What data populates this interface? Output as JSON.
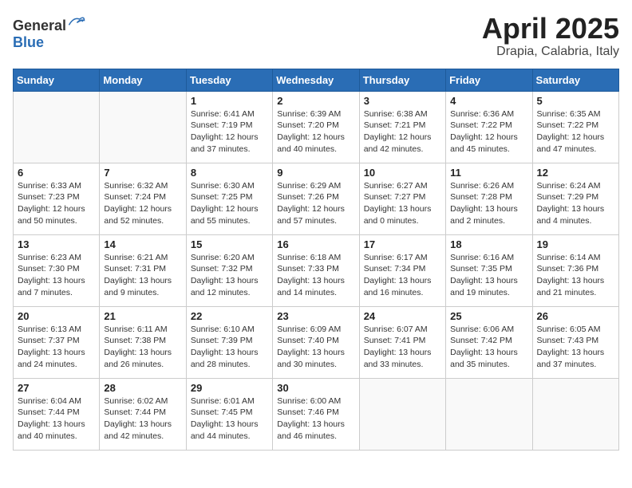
{
  "header": {
    "logo_general": "General",
    "logo_blue": "Blue",
    "month_year": "April 2025",
    "location": "Drapia, Calabria, Italy"
  },
  "weekdays": [
    "Sunday",
    "Monday",
    "Tuesday",
    "Wednesday",
    "Thursday",
    "Friday",
    "Saturday"
  ],
  "weeks": [
    [
      {
        "day": "",
        "info": ""
      },
      {
        "day": "",
        "info": ""
      },
      {
        "day": "1",
        "info": "Sunrise: 6:41 AM\nSunset: 7:19 PM\nDaylight: 12 hours\nand 37 minutes."
      },
      {
        "day": "2",
        "info": "Sunrise: 6:39 AM\nSunset: 7:20 PM\nDaylight: 12 hours\nand 40 minutes."
      },
      {
        "day": "3",
        "info": "Sunrise: 6:38 AM\nSunset: 7:21 PM\nDaylight: 12 hours\nand 42 minutes."
      },
      {
        "day": "4",
        "info": "Sunrise: 6:36 AM\nSunset: 7:22 PM\nDaylight: 12 hours\nand 45 minutes."
      },
      {
        "day": "5",
        "info": "Sunrise: 6:35 AM\nSunset: 7:22 PM\nDaylight: 12 hours\nand 47 minutes."
      }
    ],
    [
      {
        "day": "6",
        "info": "Sunrise: 6:33 AM\nSunset: 7:23 PM\nDaylight: 12 hours\nand 50 minutes."
      },
      {
        "day": "7",
        "info": "Sunrise: 6:32 AM\nSunset: 7:24 PM\nDaylight: 12 hours\nand 52 minutes."
      },
      {
        "day": "8",
        "info": "Sunrise: 6:30 AM\nSunset: 7:25 PM\nDaylight: 12 hours\nand 55 minutes."
      },
      {
        "day": "9",
        "info": "Sunrise: 6:29 AM\nSunset: 7:26 PM\nDaylight: 12 hours\nand 57 minutes."
      },
      {
        "day": "10",
        "info": "Sunrise: 6:27 AM\nSunset: 7:27 PM\nDaylight: 13 hours\nand 0 minutes."
      },
      {
        "day": "11",
        "info": "Sunrise: 6:26 AM\nSunset: 7:28 PM\nDaylight: 13 hours\nand 2 minutes."
      },
      {
        "day": "12",
        "info": "Sunrise: 6:24 AM\nSunset: 7:29 PM\nDaylight: 13 hours\nand 4 minutes."
      }
    ],
    [
      {
        "day": "13",
        "info": "Sunrise: 6:23 AM\nSunset: 7:30 PM\nDaylight: 13 hours\nand 7 minutes."
      },
      {
        "day": "14",
        "info": "Sunrise: 6:21 AM\nSunset: 7:31 PM\nDaylight: 13 hours\nand 9 minutes."
      },
      {
        "day": "15",
        "info": "Sunrise: 6:20 AM\nSunset: 7:32 PM\nDaylight: 13 hours\nand 12 minutes."
      },
      {
        "day": "16",
        "info": "Sunrise: 6:18 AM\nSunset: 7:33 PM\nDaylight: 13 hours\nand 14 minutes."
      },
      {
        "day": "17",
        "info": "Sunrise: 6:17 AM\nSunset: 7:34 PM\nDaylight: 13 hours\nand 16 minutes."
      },
      {
        "day": "18",
        "info": "Sunrise: 6:16 AM\nSunset: 7:35 PM\nDaylight: 13 hours\nand 19 minutes."
      },
      {
        "day": "19",
        "info": "Sunrise: 6:14 AM\nSunset: 7:36 PM\nDaylight: 13 hours\nand 21 minutes."
      }
    ],
    [
      {
        "day": "20",
        "info": "Sunrise: 6:13 AM\nSunset: 7:37 PM\nDaylight: 13 hours\nand 24 minutes."
      },
      {
        "day": "21",
        "info": "Sunrise: 6:11 AM\nSunset: 7:38 PM\nDaylight: 13 hours\nand 26 minutes."
      },
      {
        "day": "22",
        "info": "Sunrise: 6:10 AM\nSunset: 7:39 PM\nDaylight: 13 hours\nand 28 minutes."
      },
      {
        "day": "23",
        "info": "Sunrise: 6:09 AM\nSunset: 7:40 PM\nDaylight: 13 hours\nand 30 minutes."
      },
      {
        "day": "24",
        "info": "Sunrise: 6:07 AM\nSunset: 7:41 PM\nDaylight: 13 hours\nand 33 minutes."
      },
      {
        "day": "25",
        "info": "Sunrise: 6:06 AM\nSunset: 7:42 PM\nDaylight: 13 hours\nand 35 minutes."
      },
      {
        "day": "26",
        "info": "Sunrise: 6:05 AM\nSunset: 7:43 PM\nDaylight: 13 hours\nand 37 minutes."
      }
    ],
    [
      {
        "day": "27",
        "info": "Sunrise: 6:04 AM\nSunset: 7:44 PM\nDaylight: 13 hours\nand 40 minutes."
      },
      {
        "day": "28",
        "info": "Sunrise: 6:02 AM\nSunset: 7:44 PM\nDaylight: 13 hours\nand 42 minutes."
      },
      {
        "day": "29",
        "info": "Sunrise: 6:01 AM\nSunset: 7:45 PM\nDaylight: 13 hours\nand 44 minutes."
      },
      {
        "day": "30",
        "info": "Sunrise: 6:00 AM\nSunset: 7:46 PM\nDaylight: 13 hours\nand 46 minutes."
      },
      {
        "day": "",
        "info": ""
      },
      {
        "day": "",
        "info": ""
      },
      {
        "day": "",
        "info": ""
      }
    ]
  ]
}
